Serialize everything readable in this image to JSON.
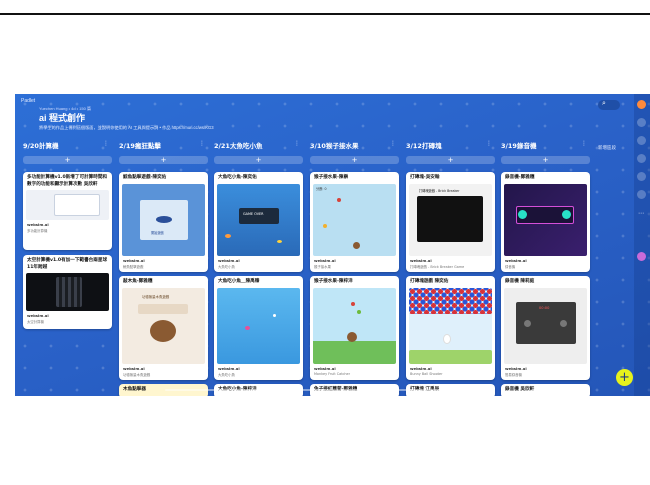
{
  "app": {
    "brand": "Padlet",
    "meta": "Yuechen Huang • 4d • 150 篇",
    "title": "ai 程式創作",
    "subtitle": "將學生的作品上傳到這個版面，並說明你使用的 AI 工具與提示詞 • 作品 https://muri.cc/ws/KG3",
    "right_label": "新增區段"
  },
  "columns": [
    {
      "title": "9/20計算機",
      "cards": [
        {
          "title": "多功能計算機v1.0新增了可計算時間和數字的功能和顯示計算次數 吳欣軒",
          "source": "websim.ai",
          "caption": "多功能計算機"
        },
        {
          "title": "太空計算機v1.0有加一下範書台兩星球11年跨越",
          "source": "websim.ai",
          "caption": "太空計算機"
        }
      ]
    },
    {
      "title": "2/19瘋狂點擊",
      "cards": [
        {
          "title": "鯨魚點擊遊戲-陳奕佑",
          "source": "websim.ai",
          "caption": "鯨魚點擊遊戲"
        },
        {
          "title": "敲木魚-鄭雅穗",
          "source": "websim.ai",
          "caption": "功德無量木魚遊戲"
        },
        {
          "title": "木魚點擊器"
        }
      ]
    },
    {
      "title": "2/21大魚吃小魚",
      "cards": [
        {
          "title": "大魚吃小魚-陳奕佑",
          "source": "websim.ai",
          "caption": "大魚吃小魚"
        },
        {
          "title": "大魚吃小魚＿陳禹臻",
          "source": "websim.ai",
          "caption": "大魚吃小魚"
        },
        {
          "title": "大魚吃小魚-陳梓洋"
        }
      ]
    },
    {
      "title": "3/10猴子接水果",
      "cards": [
        {
          "title": "猴子接水果-陳楙",
          "source": "websim.ai",
          "caption": "猴子接水果"
        },
        {
          "title": "猴子接水果-陳梓洋",
          "source": "websim.ai",
          "caption": "Monkey Fruit Catcher"
        },
        {
          "title": "兔子接紅蘿蔔-鄭雅穗"
        }
      ]
    },
    {
      "title": "3/12打磚塊",
      "cards": [
        {
          "title": "打磚塊-吳安翰",
          "source": "websim.ai",
          "caption": "打磚塊遊戲 - Brick Breaker Game"
        },
        {
          "title": "打磚塊遊戲 陳奕佑",
          "source": "websim.ai",
          "caption": "Bunny Ball Shooter"
        },
        {
          "title": "打磚塊 江禹辰"
        }
      ]
    },
    {
      "title": "3/19錄音機",
      "cards": [
        {
          "title": "錄音機-鄭雅穗",
          "source": "websim.ai",
          "caption": "錄音機"
        },
        {
          "title": "錄音機 陳莉庭",
          "source": "websim.ai",
          "caption": "簡易錄音機"
        },
        {
          "title": "錄音機 吳欣軒"
        }
      ]
    }
  ],
  "thumb_texts": {
    "whale": "開始遊戲",
    "bigfish": "GAME OVER",
    "brick": "打磚塊遊戲 - Brick Breaker",
    "recorder": "00:00",
    "muyu": "功德無量木魚遊戲",
    "monkey": "分數: 0"
  },
  "colors": {
    "background": "#2a62c9",
    "card": "#ffffff",
    "fab": "#e6f21c",
    "accent_avatar": "#ff8a3d"
  }
}
